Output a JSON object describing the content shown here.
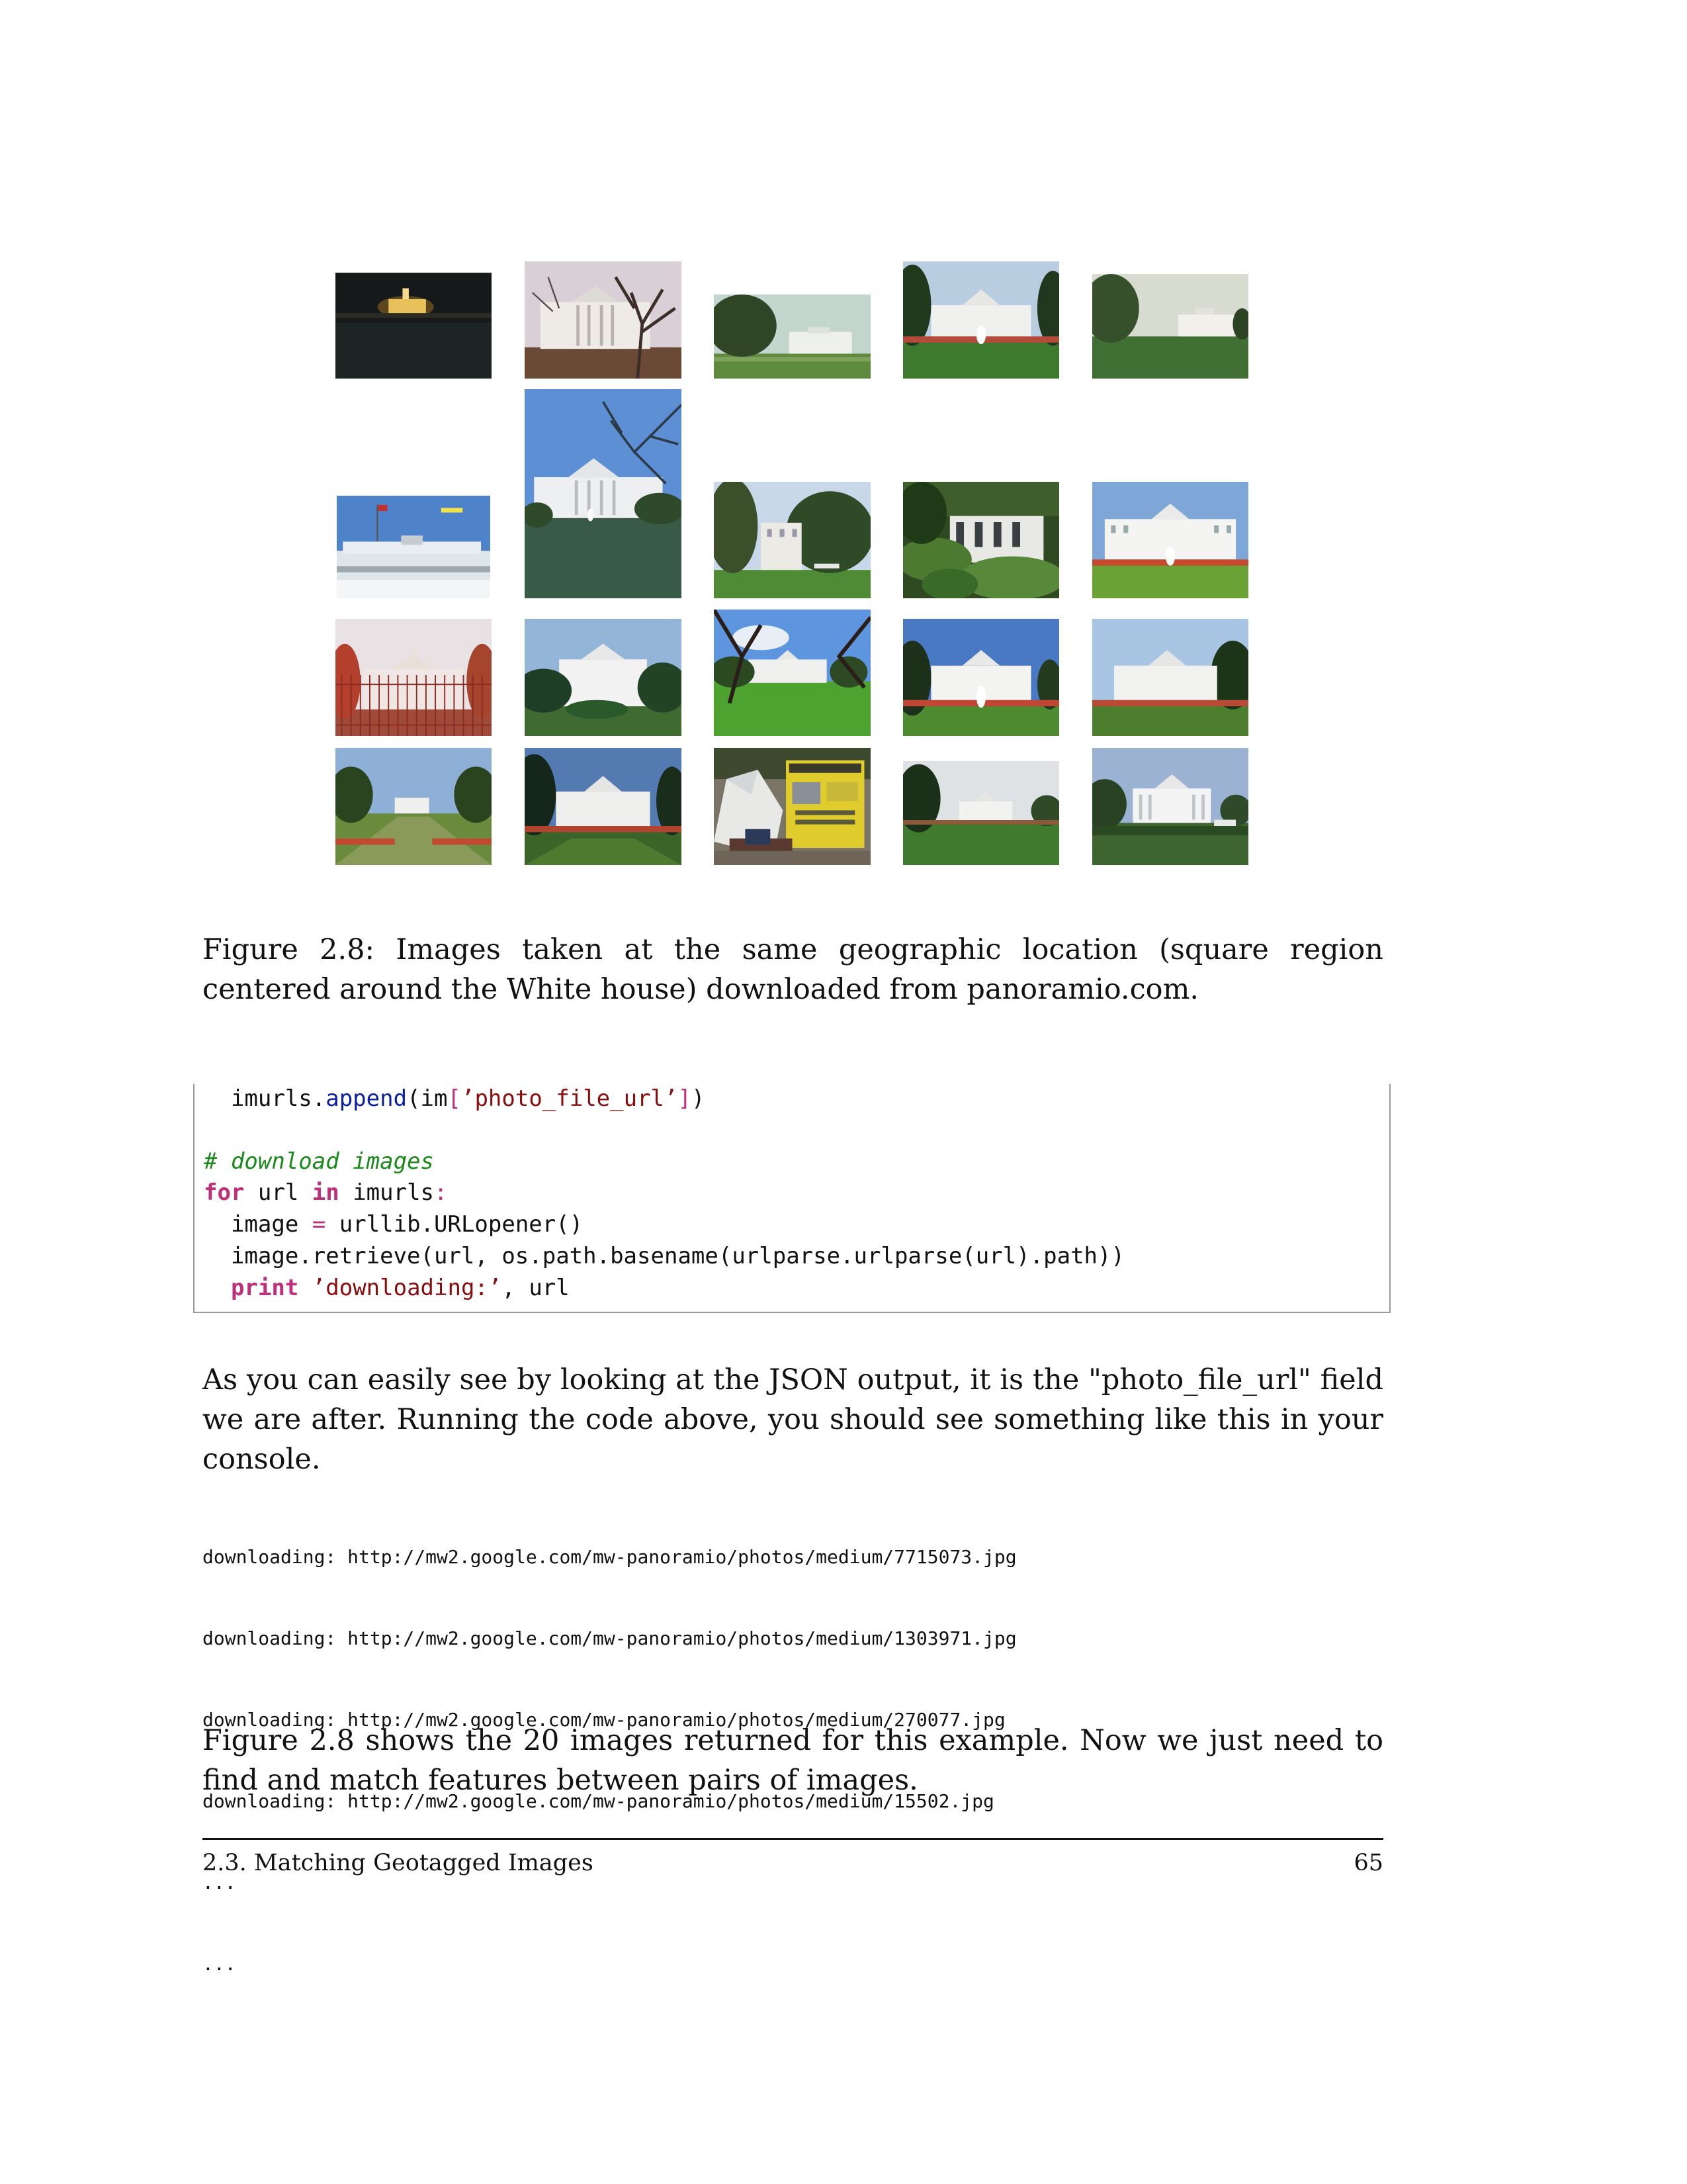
{
  "figure": {
    "photos": [
      {
        "scene": "white-house-night"
      },
      {
        "scene": "white-house-winter-trees"
      },
      {
        "scene": "white-house-distant-lawn"
      },
      {
        "scene": "white-house-north-fountain"
      },
      {
        "scene": "white-house-north-lawn-overcast"
      },
      {
        "scene": "white-house-roof-flag"
      },
      {
        "scene": "white-house-portico-tree"
      },
      {
        "scene": "white-house-garden-trees"
      },
      {
        "scene": "white-house-garden-close"
      },
      {
        "scene": "white-house-south-fountain"
      },
      {
        "scene": "white-house-fence-autumn"
      },
      {
        "scene": "white-house-south-trees"
      },
      {
        "scene": "white-house-south-lawn-sunny"
      },
      {
        "scene": "white-house-north-fountain-2"
      },
      {
        "scene": "white-house-north-sunny"
      },
      {
        "scene": "white-house-ellipse-wide"
      },
      {
        "scene": "white-house-north-flowers"
      },
      {
        "scene": "protest-tent-signs"
      },
      {
        "scene": "white-house-lawn-flowers"
      },
      {
        "scene": "white-house-south-hazy"
      }
    ],
    "caption": "Figure 2.8: Images taken at the same geographic location (square region centered around the White house) downloaded from panoramio.com."
  },
  "code": {
    "l1": {
      "a": "  imurls.",
      "fn": "append",
      "b": "(im",
      "open": "[",
      "str": "’photo_file_url’",
      "close": "]",
      "c": ")"
    },
    "comment": "# download images",
    "l3": {
      "kw1": "for",
      "a": " url ",
      "kw2": "in",
      "b": " imurls",
      "colon": ":"
    },
    "l4": {
      "a": "  image ",
      "eq": "=",
      "b": " urllib.URLopener()"
    },
    "l5": "  image.retrieve(url, os.path.basename(urlparse.urlparse(url).path))",
    "l6": {
      "indent": "  ",
      "kw": "print",
      "space": " ",
      "str": "’downloading:’",
      "rest": ", url"
    }
  },
  "paragraph1": "As you can easily see by looking at the JSON output, it is the \"photo_file_url\" field we are after. Running the code above, you should see something like this in your console.",
  "console": [
    "downloading: http://mw2.google.com/mw-panoramio/photos/medium/7715073.jpg",
    "downloading: http://mw2.google.com/mw-panoramio/photos/medium/1303971.jpg",
    "downloading: http://mw2.google.com/mw-panoramio/photos/medium/270077.jpg",
    "downloading: http://mw2.google.com/mw-panoramio/photos/medium/15502.jpg",
    "...",
    "..."
  ],
  "paragraph2": "Figure 2.8 shows the 20 images returned for this example. Now we just need to find and match features between pairs of images.",
  "footer": {
    "section": "2.3. Matching Geotagged Images",
    "page": "65"
  }
}
